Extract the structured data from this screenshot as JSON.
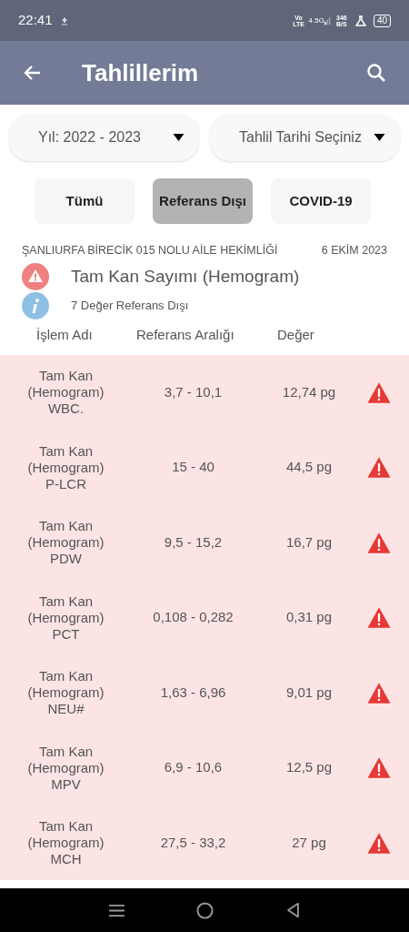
{
  "status_bar": {
    "time": "22:41",
    "volte": "Vo LTE",
    "network": "4.5G",
    "speed": "346 B/S",
    "battery": "40"
  },
  "app_bar": {
    "title": "Tahlillerim"
  },
  "filters": [
    {
      "label": "Yıl: 2022 - 2023"
    },
    {
      "label": "Tahlil Tarihi Seçiniz"
    }
  ],
  "tabs": [
    {
      "label": "Tümü",
      "selected": false
    },
    {
      "label": "Referans Dışı",
      "selected": true
    },
    {
      "label": "COVID-19",
      "selected": false
    }
  ],
  "report": {
    "institution": "ŞANLIURFA BİRECİK 015 NOLU AİLE HEKİMLİĞİ",
    "date": "6 EKİM 2023",
    "test": "Tam Kan Sayımı (Hemogram)",
    "summary": "7 Değer Referans Dışı"
  },
  "table": {
    "columns": [
      "İşlem Adı",
      "Referans Aralığı",
      "Değer"
    ],
    "rows": [
      {
        "name": [
          "Tam Kan",
          "(Hemogram)",
          "WBC."
        ],
        "range": "3,7 - 10,1",
        "value": "12,74 pg",
        "out_of_range": true
      },
      {
        "name": [
          "Tam Kan",
          "(Hemogram)",
          "P-LCR"
        ],
        "range": "15 - 40",
        "value": "44,5 pg",
        "out_of_range": true
      },
      {
        "name": [
          "Tam Kan",
          "(Hemogram)",
          "PDW"
        ],
        "range": "9,5 - 15,2",
        "value": "16,7 pg",
        "out_of_range": true
      },
      {
        "name": [
          "Tam Kan",
          "(Hemogram)",
          "PCT"
        ],
        "range": "0,108 - 0,282",
        "value": "0,31 pg",
        "out_of_range": true
      },
      {
        "name": [
          "Tam Kan",
          "(Hemogram)",
          "NEU#"
        ],
        "range": "1,63 - 6,96",
        "value": "9,01 pg",
        "out_of_range": true
      },
      {
        "name": [
          "Tam Kan",
          "(Hemogram)",
          "MPV"
        ],
        "range": "6,9 - 10,6",
        "value": "12,5 pg",
        "out_of_range": true
      },
      {
        "name": [
          "Tam Kan",
          "(Hemogram)",
          "MCH"
        ],
        "range": "27,5 - 33,2",
        "value": "27 pg",
        "out_of_range": true
      }
    ]
  }
}
